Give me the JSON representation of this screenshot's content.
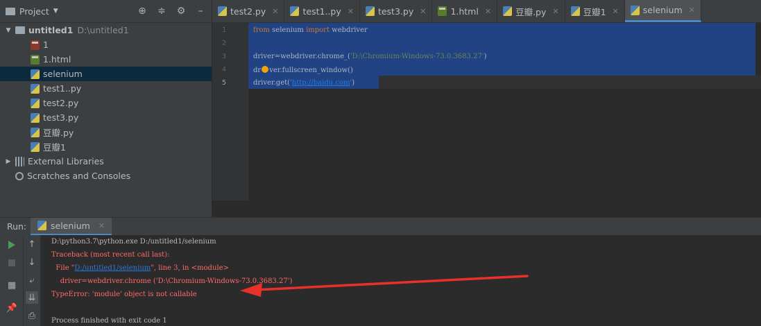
{
  "project_panel": {
    "title": "Project",
    "root": {
      "name": "untitled1",
      "path": "D:\\untitled1"
    },
    "files": [
      {
        "name": "1",
        "icon": "red-file-icon"
      },
      {
        "name": "1.html",
        "icon": "html-file-icon"
      },
      {
        "name": "selenium",
        "icon": "python-file-icon"
      },
      {
        "name": "test1..py",
        "icon": "python-file-icon"
      },
      {
        "name": "test2.py",
        "icon": "python-file-icon"
      },
      {
        "name": "test3.py",
        "icon": "python-file-icon"
      },
      {
        "name": "豆瓣.py",
        "icon": "python-file-icon"
      },
      {
        "name": "豆瓣1",
        "icon": "python-file-icon"
      }
    ],
    "external_libraries": "External Libraries",
    "scratches": "Scratches and Consoles"
  },
  "editor_tabs": [
    {
      "label": "test2.py"
    },
    {
      "label": "test1..py"
    },
    {
      "label": "test3.py"
    },
    {
      "label": "1.html"
    },
    {
      "label": "豆瓣.py"
    },
    {
      "label": "豆瓣1"
    },
    {
      "label": "selenium",
      "active": true
    }
  ],
  "code": {
    "line_numbers": [
      "1",
      "2",
      "3",
      "4",
      "5"
    ],
    "l1_from": "from",
    "l1_mod": " selenium ",
    "l1_import": "import",
    "l1_name": " webdriver",
    "l3_code": "driver=webdriver.chrome_(",
    "l3_str": "'D:\\Chromium-Windows-73.0.3683.27'",
    "l3_end": ")",
    "l4_a": "dr",
    "l4_b": "ver.fullscreen_window()",
    "l5_code": "driver.get(",
    "l5_q1": "'",
    "l5_url": "http://baidu.com",
    "l5_q2": "'",
    "l5_end": ")"
  },
  "run_panel": {
    "label": "Run:",
    "tab": "selenium",
    "console": {
      "cmd": "D:\\python3.7\\python.exe D:/untitled1/selenium",
      "traceback": "Traceback (most recent call last):",
      "file_pre": "  File \"",
      "file_link": "D:/untitled1/selenium",
      "file_post": "\", line 3, in <module>",
      "code_line": "    driver=webdriver.chrome ('D:\\Chromium-Windows-73.0.3683.27')",
      "error": "TypeError: 'module' object is not callable",
      "finish": "Process finished with exit code 1"
    }
  },
  "colors": {
    "selection": "#214283",
    "error_text": "#ff6b68",
    "annotation_arrow": "#e8312a",
    "active_tab_underline": "#4a88c7"
  }
}
